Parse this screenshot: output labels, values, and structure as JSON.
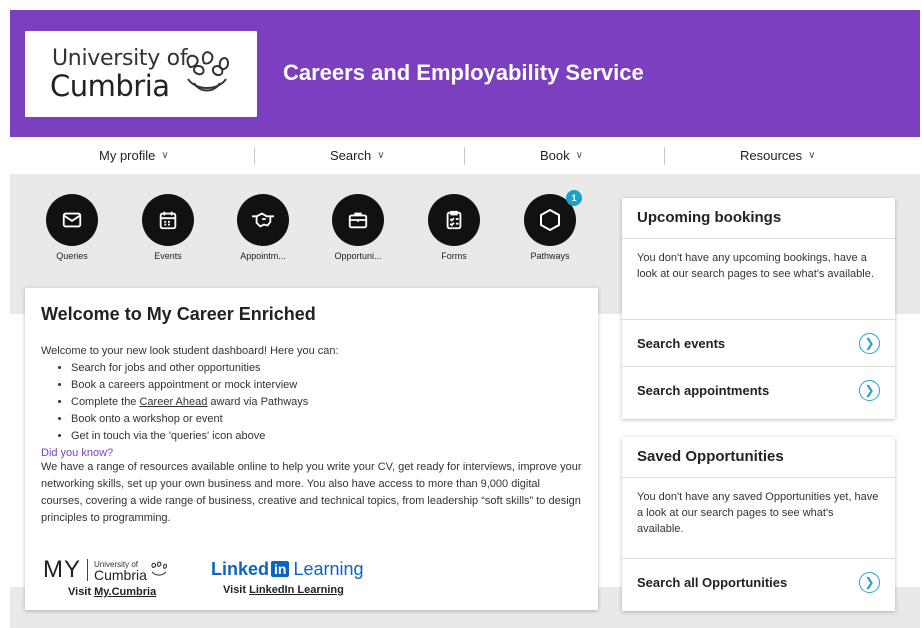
{
  "header": {
    "logo_line1": "University of",
    "logo_line2": "Cumbria",
    "title": "Careers and Employability Service"
  },
  "nav": [
    {
      "label": "My profile"
    },
    {
      "label": "Search"
    },
    {
      "label": "Book"
    },
    {
      "label": "Resources"
    }
  ],
  "quick_links": [
    {
      "label": "Queries",
      "icon": "envelope-icon"
    },
    {
      "label": "Events",
      "icon": "calendar-icon"
    },
    {
      "label": "Appointm...",
      "icon": "handshake-icon"
    },
    {
      "label": "Opportuni...",
      "icon": "briefcase-icon"
    },
    {
      "label": "Forms",
      "icon": "clipboard-icon"
    },
    {
      "label": "Pathways",
      "icon": "hexagon-icon",
      "badge": "1"
    }
  ],
  "welcome": {
    "title": "Welcome to My Career Enriched",
    "intro": "Welcome to your new look student dashboard! Here you can:",
    "bullets": {
      "b1": "Search for jobs and other opportunities",
      "b2": "Book a careers appointment or mock interview",
      "b3_pre": "Complete the ",
      "b3_link": "Career Ahead",
      "b3_post": " award via Pathways",
      "b4": "Book onto a workshop or event",
      "b5": "Get in touch via the 'queries' icon above"
    },
    "did_you_know": "Did you know?",
    "body": "We have a range of resources available online to help you write your CV, get ready for interviews, improve your networking skills, set up your own business and more. You also have access to more than 9,000 digital courses, covering a wide range of business, creative and technical topics, from leadership “soft skills” to design principles to programming.",
    "my_brand": "MY",
    "my_uni1": "University of",
    "my_uni2": "Cumbria",
    "visit_prefix": "Visit ",
    "visit_my": "My.Cumbria",
    "linkedin_word": "Linked",
    "linkedin_in": "in",
    "linkedin_learning": "Learning",
    "visit_linkedin": "LinkedIn Learning"
  },
  "upcoming": {
    "title": "Upcoming bookings",
    "body": "You don't have any upcoming bookings, have a look at our search pages to see what's available.",
    "links": [
      "Search events",
      "Search appointments"
    ]
  },
  "saved": {
    "title": "Saved Opportunities",
    "body": "You don't have any saved Opportunities yet, have a look at our search pages to see what's available.",
    "links": [
      "Search all Opportunities"
    ]
  },
  "colors": {
    "brand_purple": "#7b3fbf",
    "accent_teal": "#2aa0c8",
    "linkedin_blue": "#0a66c2"
  }
}
